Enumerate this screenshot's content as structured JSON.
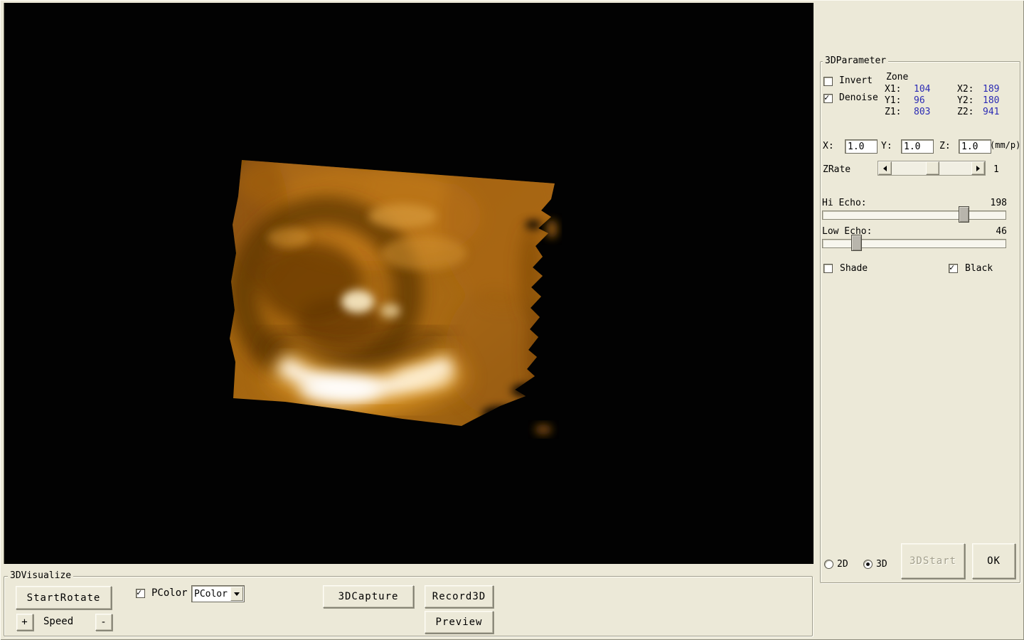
{
  "parameter_panel": {
    "title": "3DParameter",
    "invert": {
      "label": "Invert",
      "checked": false
    },
    "denoise": {
      "label": "Denoise",
      "checked": true
    },
    "zone": {
      "title": "Zone",
      "x1_label": "X1:",
      "x1": "104",
      "x2_label": "X2:",
      "x2": "189",
      "y1_label": "Y1:",
      "y1": "96",
      "y2_label": "Y2:",
      "y2": "180",
      "z1_label": "Z1:",
      "z1": "803",
      "z2_label": "Z2:",
      "z2": "941"
    },
    "scale": {
      "x_label": "X:",
      "x": "1.0",
      "y_label": "Y:",
      "y": "1.0",
      "z_label": "Z:",
      "z": "1.0",
      "unit": "(mm/p)"
    },
    "zrate": {
      "label": "ZRate",
      "value": "1"
    },
    "hi_echo": {
      "label": "Hi Echo:",
      "value": 198,
      "max": 255
    },
    "low_echo": {
      "label": "Low Echo:",
      "value": 46,
      "max": 255
    },
    "shade": {
      "label": "Shade",
      "checked": false
    },
    "black": {
      "label": "Black",
      "checked": true
    },
    "mode_2d": {
      "label": "2D",
      "selected": false
    },
    "mode_3d": {
      "label": "3D",
      "selected": true
    },
    "start3d_label": "3DStart",
    "ok_label": "OK"
  },
  "visualize_panel": {
    "title": "3DVisualize",
    "start_rotate_label": "StartRotate",
    "speed": {
      "plus": "+",
      "label": "Speed",
      "minus": "-"
    },
    "pcolor_checkbox": {
      "label": "PColor",
      "checked": true
    },
    "pcolor_select": {
      "value": "PColor"
    },
    "capture_label": "3DCapture",
    "record_label": "Record3D",
    "preview_label": "Preview"
  },
  "colors": {
    "window_bg": "#ece9d8",
    "viewport_bg": "#020202",
    "zone_value_text": "#2b2bb4",
    "render_amber": "#a96a14",
    "render_highlight": "#fff7e8"
  }
}
